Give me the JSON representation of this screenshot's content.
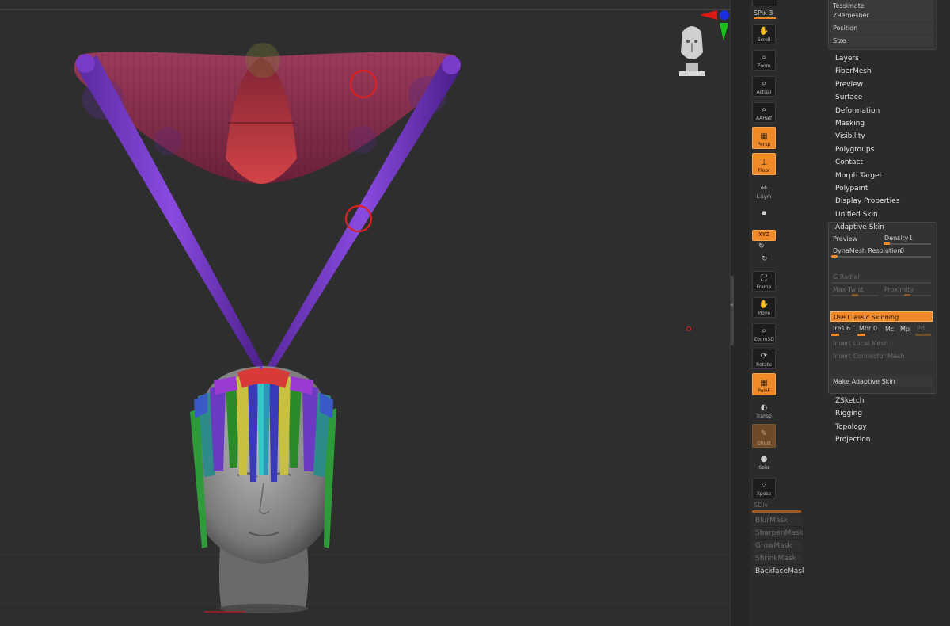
{
  "shelf": {
    "top_label": "SPix 3",
    "buttons": [
      {
        "id": "scroll",
        "label": "Scroll",
        "icon": "hand-icon",
        "state": "off"
      },
      {
        "id": "zoom",
        "label": "Zoom",
        "icon": "magnifier-icon",
        "state": "off"
      },
      {
        "id": "actual",
        "label": "Actual",
        "icon": "magnifier-icon",
        "state": "off"
      },
      {
        "id": "aahalf",
        "label": "AAHalf",
        "icon": "magnifier-icon",
        "state": "off"
      },
      {
        "id": "persp",
        "label": "Persp",
        "icon": "grid-icon",
        "state": "on"
      },
      {
        "id": "floor",
        "label": "Floor",
        "icon": "floor-icon",
        "state": "on"
      },
      {
        "id": "lsym",
        "label": "L.Sym",
        "icon": "symmetry-icon",
        "state": "off"
      },
      {
        "id": "lock",
        "label": "",
        "icon": "lock-icon",
        "state": "off"
      },
      {
        "id": "xyz",
        "label": "XYZ",
        "icon": "rotate-axis-icon",
        "state": "on"
      },
      {
        "id": "frame",
        "label": "Frame",
        "icon": "frame-icon",
        "state": "off"
      },
      {
        "id": "move",
        "label": "Move",
        "icon": "hand-icon",
        "state": "off"
      },
      {
        "id": "zoom3d",
        "label": "Zoom3D",
        "icon": "magnifier-icon",
        "state": "off"
      },
      {
        "id": "rotate",
        "label": "Rotate",
        "icon": "rotate-icon",
        "state": "off"
      },
      {
        "id": "polyf",
        "label": "PolyF",
        "icon": "polyframe-icon",
        "state": "on"
      },
      {
        "id": "transp",
        "label": "Transp",
        "icon": "transparency-icon",
        "state": "off"
      },
      {
        "id": "ghost",
        "label": "Ghost",
        "icon": "ghost-icon",
        "state": "dim"
      },
      {
        "id": "solo",
        "label": "Solo",
        "icon": "solo-icon",
        "state": "off"
      },
      {
        "id": "xpose",
        "label": "Xpose",
        "icon": "xpose-icon",
        "state": "off"
      }
    ],
    "sdiv_label": "SDiv",
    "mask_items": [
      {
        "label": "BlurMask",
        "dim": true
      },
      {
        "label": "SharpenMask",
        "dim": true
      },
      {
        "label": "GrowMask",
        "dim": true
      },
      {
        "label": "ShrinkMask",
        "dim": true
      },
      {
        "label": "BackfaceMask",
        "dim": false
      }
    ]
  },
  "panel": {
    "top_items": [
      "Tessimate",
      "ZRemesher",
      "Position",
      "Size"
    ],
    "menus": [
      "Layers",
      "FiberMesh",
      "Preview",
      "Surface",
      "Deformation",
      "Masking",
      "Visibility",
      "Polygroups",
      "Contact",
      "Morph Target",
      "Polypaint",
      "Display Properties",
      "Unified Skin"
    ],
    "adaptive": {
      "title": "Adaptive Skin",
      "preview": "Preview",
      "density_label": "Density",
      "density_value": "1",
      "dynamesh_label": "DynaMesh Resolution",
      "dynamesh_value": "0",
      "g_radial": "G Radial",
      "max_twist": "Max Twist",
      "proximity": "Proximity",
      "classic": "Use Classic Skinning",
      "ires_label": "Ires",
      "ires_value": "6",
      "mbr_label": "Mbr",
      "mbr_value": "0",
      "mc": "Mc",
      "mp": "Mp",
      "pd": "Pd",
      "insert_local": "Insert Local Mesh",
      "insert_connector": "Insert Connector Mesh",
      "make": "Make Adaptive Skin"
    },
    "menus_after": [
      "ZSketch",
      "Rigging",
      "Topology",
      "Projection"
    ]
  },
  "colors": {
    "accent": "#f08a28",
    "bone": "#7a3bc8",
    "membrane": "#8a3050",
    "highlight_circle": "#e02020"
  }
}
